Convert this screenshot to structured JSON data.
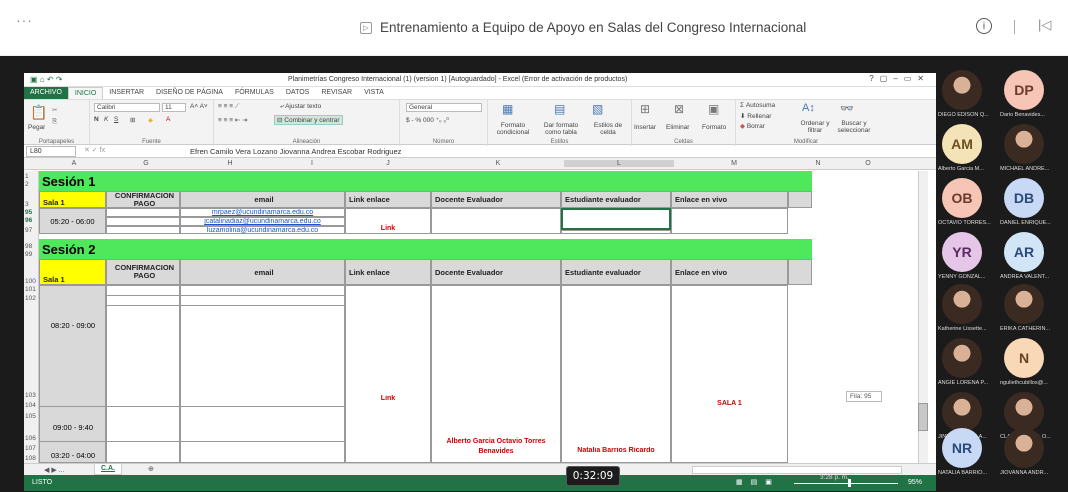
{
  "meeting": {
    "title": "Entrenamiento a Equipo de Apoyo en Salas del Congreso Internacional",
    "timer": "0:32:09"
  },
  "excel": {
    "window_title": "Planimetrías Congreso Internacional (1) (version 1) [Autoguardado] - Excel (Error de activación de productos)",
    "tabs": [
      "ARCHIVO",
      "INICIO",
      "INSERTAR",
      "DISEÑO DE PÁGINA",
      "FÓRMULAS",
      "DATOS",
      "REVISAR",
      "VISTA"
    ],
    "ribbon": {
      "paste": "Pegar",
      "clipboard": "Portapapeles",
      "font": "Calibri",
      "font_size": "11",
      "font_group": "Fuente",
      "wrap": "Ajustar texto",
      "merge": "Combinar y centrar",
      "alignment": "Alineación",
      "number_format": "General",
      "number_group": "Número",
      "cond_format": "Formato condicional",
      "as_table": "Dar formato como tabla",
      "cell_styles": "Estilos de celda",
      "styles": "Estilos",
      "insert": "Insertar",
      "delete": "Eliminar",
      "format": "Formato",
      "cells": "Celdas",
      "autosum": "Autosuma",
      "fill": "Rellenar",
      "clear": "Borrar",
      "sort": "Ordenar y filtrar",
      "find": "Buscar y seleccionar",
      "modify": "Modificar"
    },
    "name_box": "L80",
    "formula": "Efren Camilo Vera Lozano        Jiovanna Andrea Escobar Rodriguez",
    "columns": [
      "A",
      "G",
      "H",
      "I",
      "J",
      "K",
      "L",
      "M",
      "N",
      "O"
    ],
    "session1": "Sesión 1",
    "session2": "Sesión 2",
    "sala": "Sala 1",
    "headers": {
      "pago": "CONFIRMACION PAGO",
      "email": "email",
      "link": "Link enlace",
      "docente": "Docente Evaluador",
      "estudiante": "Estudiante evaluador",
      "vivo": "Enlace en vivo"
    },
    "emails": [
      "mrpaez@ucundinamarca.edu.co",
      "jcatalinadiaz@ucundinamarca.edu.co",
      "luzamolina@ucundinamarca.edu.co"
    ],
    "times": [
      "05:20 - 06:00",
      "08:20 - 09:00",
      "09:00 - 9:40",
      "03:20 - 04:00"
    ],
    "link_text": "Link",
    "docente_name": "Alberto Garcia Octavio Torres Benavides",
    "estudiante_name": "Natalia Barrios Ricardo",
    "sala_label": "SALA 1",
    "fila_tip": "Fila: 95",
    "rows": [
      "1",
      "2",
      "3",
      "95",
      "96",
      "97",
      "98",
      "99",
      "100",
      "101",
      "102",
      "103",
      "104",
      "105",
      "106",
      "107",
      "108"
    ],
    "sheet_tab": "C.A.",
    "status": "LISTO",
    "zoom": "95%",
    "clock": "3:28 p. m."
  },
  "participants": [
    {
      "initials": "",
      "name": "DIEGO EDISON Q...",
      "color": ""
    },
    {
      "initials": "DP",
      "name": "Dario Benavides...",
      "color": "#f6c5b5"
    },
    {
      "initials": "AM",
      "name": "Alberto Garcia M...",
      "color": "#f5e3b8"
    },
    {
      "initials": "",
      "name": "MICHAEL ANDRE...",
      "color": ""
    },
    {
      "initials": "OB",
      "name": "OCTAVIO TORRES...",
      "color": "#f6c5b5"
    },
    {
      "initials": "DB",
      "name": "DANIEL ENRIQUE...",
      "color": "#c8d9f5"
    },
    {
      "initials": "YR",
      "name": "YENNY GONZAL...",
      "color": "#e6c6e8"
    },
    {
      "initials": "AR",
      "name": "ANDREA VALENT...",
      "color": "#d2e5f7"
    },
    {
      "initials": "",
      "name": "Katherine Lissette...",
      "color": ""
    },
    {
      "initials": "",
      "name": "ERIKA CATHERIN...",
      "color": ""
    },
    {
      "initials": "",
      "name": "ANGIE LORENA P...",
      "color": ""
    },
    {
      "initials": "N",
      "name": "nguliethcubillos@...",
      "color": "#f9d8b8"
    },
    {
      "initials": "",
      "name": "JINETH DANIELA...",
      "color": ""
    },
    {
      "initials": "",
      "name": "CLAIRE ISABEL O...",
      "color": ""
    },
    {
      "initials": "NR",
      "name": "NATALIA BARRIO...",
      "color": "#c8d9f5"
    },
    {
      "initials": "",
      "name": "JIOVANNA ANDR...",
      "color": ""
    }
  ]
}
